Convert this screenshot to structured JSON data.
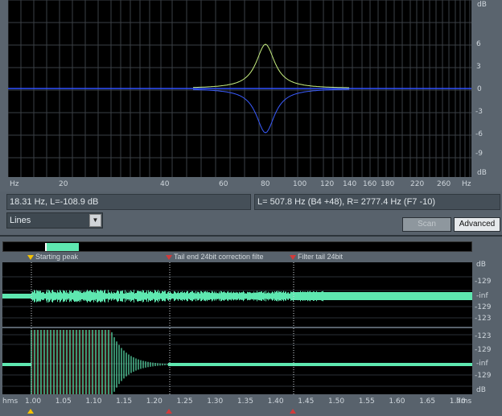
{
  "spectrum": {
    "unit_top": "dB",
    "db_labels": [
      "6",
      "3",
      "0",
      "-3",
      "-6",
      "-9"
    ],
    "db_bottom": "dB",
    "freq_unit_left": "Hz",
    "freq_unit_right": "Hz",
    "freq_labels": [
      "20",
      "40",
      "60",
      "80",
      "100",
      "120",
      "140",
      "160",
      "180",
      "220",
      "260"
    ],
    "readout_left": "18.31 Hz, L=-108.9 dB",
    "readout_right": "L=  507.8 Hz (B4 +48), R= 2777.4 Hz (F7 -10)"
  },
  "view_select": {
    "value": "Lines",
    "arrow": "▼"
  },
  "buttons": {
    "scan": "Scan",
    "advanced": "Advanced"
  },
  "markers": {
    "m1": "Starting peak",
    "m2": "Tail end 24bit correction filte",
    "m3": "Filter tail 24bit"
  },
  "waveform": {
    "top_labels": [
      "dB",
      "-129",
      "-inf",
      "-129",
      "-123"
    ],
    "bottom_labels": [
      "-123",
      "-129",
      "-inf",
      "-129",
      "dB"
    ]
  },
  "time_axis": {
    "unit_left": "hms",
    "unit_right": "hms",
    "ticks": [
      "1.00",
      "1.05",
      "1.10",
      "1.15",
      "1.20",
      "1.25",
      "1.30",
      "1.35",
      "1.40",
      "1.45",
      "1.50",
      "1.55",
      "1.60",
      "1.65",
      "1.70"
    ]
  },
  "colors": {
    "waveform": "#5ee7b0",
    "curve_green": "#c8f080",
    "curve_blue": "#3a5cff",
    "marker_yellow": "#f5c200",
    "marker_red": "#d23a3a"
  }
}
